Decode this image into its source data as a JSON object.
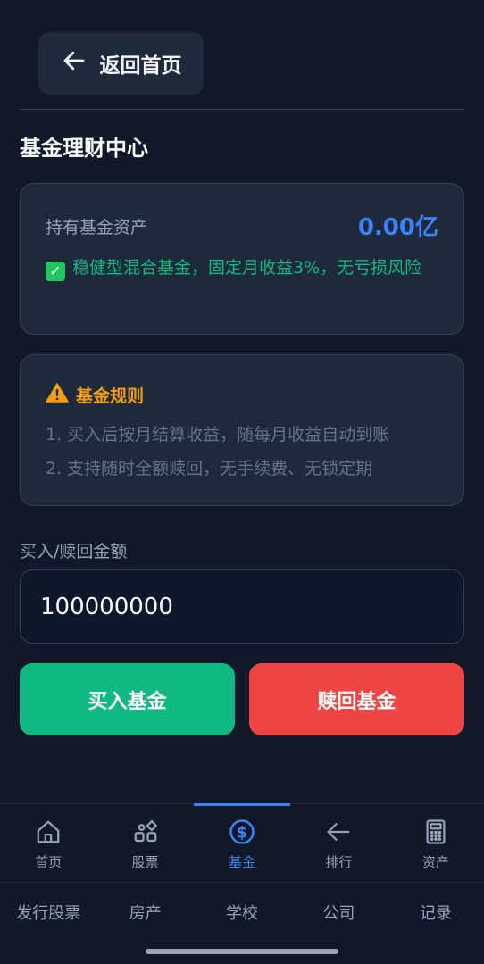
{
  "header": {
    "back_label": "返回首页",
    "title": "基金理财中心"
  },
  "asset_card": {
    "label": "持有基金资产",
    "value": "0.00亿",
    "note": "稳健型混合基金，固定月收益3%，无亏损风险"
  },
  "rules_card": {
    "title": "基金规则",
    "rules": [
      "1. 买入后按月结算收益，随每月收益自动到账",
      "2. 支持随时全额赎回，无手续费、无锁定期"
    ]
  },
  "amount": {
    "label": "买入/赎回金额",
    "value": "100000000"
  },
  "actions": {
    "buy_label": "买入基金",
    "redeem_label": "赎回基金"
  },
  "tabbar": {
    "items": [
      {
        "label": "首页",
        "icon": "home-icon"
      },
      {
        "label": "股票",
        "icon": "shapes-icon"
      },
      {
        "label": "基金",
        "icon": "dollar-circle-icon",
        "active": true
      },
      {
        "label": "排行",
        "icon": "arrow-left-icon"
      },
      {
        "label": "资产",
        "icon": "calculator-icon"
      }
    ]
  },
  "subnav": {
    "items": [
      "发行股票",
      "房产",
      "学校",
      "公司",
      "记录"
    ]
  },
  "colors": {
    "background": "#111827",
    "card": "#1e293b",
    "accent": "#3b82f6",
    "success": "#10b981",
    "danger": "#ef4444",
    "warning": "#f59e0b"
  }
}
